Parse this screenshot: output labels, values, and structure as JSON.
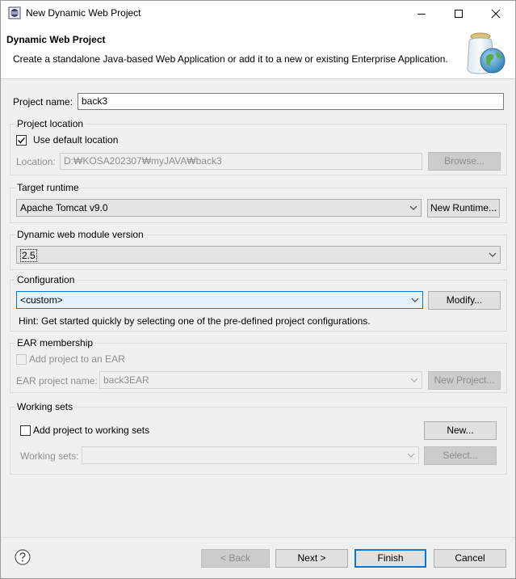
{
  "window": {
    "title": "New Dynamic Web Project"
  },
  "banner": {
    "title": "Dynamic Web Project",
    "description": "Create a standalone Java-based Web Application or add it to a new or existing Enterprise Application."
  },
  "project_name": {
    "label": "Project name:",
    "value": "back3"
  },
  "project_location": {
    "group_title": "Project location",
    "use_default_label": "Use default location",
    "use_default_checked": true,
    "location_label": "Location:",
    "location_value": "D:₩KOSA202307₩myJAVA₩back3",
    "browse_label": "Browse..."
  },
  "target_runtime": {
    "group_title": "Target runtime",
    "selected": "Apache Tomcat v9.0",
    "new_runtime_label": "New Runtime..."
  },
  "web_module": {
    "group_title": "Dynamic web module version",
    "selected": "2.5"
  },
  "configuration": {
    "group_title": "Configuration",
    "selected": "<custom>",
    "modify_label": "Modify...",
    "hint": "Hint: Get started quickly by selecting one of the pre-defined project configurations."
  },
  "ear": {
    "group_title": "EAR membership",
    "add_label": "Add project to an EAR",
    "add_checked": false,
    "project_name_label": "EAR project name:",
    "project_name_value": "back3EAR",
    "new_project_label": "New Project..."
  },
  "working_sets": {
    "group_title": "Working sets",
    "add_label": "Add project to working sets",
    "add_checked": false,
    "new_label": "New...",
    "sets_label": "Working sets:",
    "sets_value": "",
    "select_label": "Select..."
  },
  "footer": {
    "back_label": "< Back",
    "next_label": "Next >",
    "finish_label": "Finish",
    "cancel_label": "Cancel"
  },
  "icons": {
    "app": "eclipse-icon",
    "help": "help-icon",
    "banner": "web-project-globe-icon"
  },
  "colors": {
    "accent": "#0078d7",
    "focused_combo_bg": "#e5f1fb"
  }
}
